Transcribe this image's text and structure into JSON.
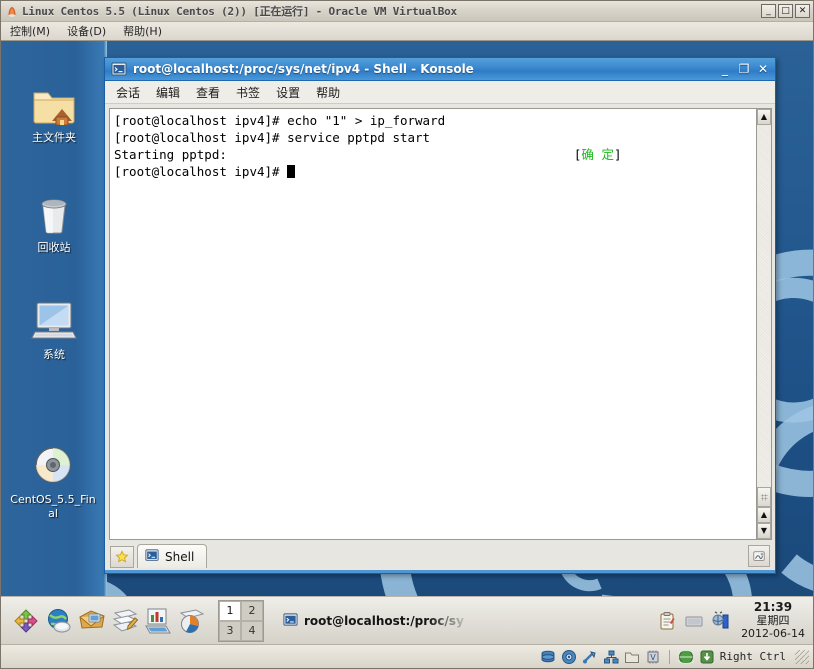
{
  "vbox": {
    "title": "Linux Centos 5.5 (Linux Centos (2)) [正在运行] - Oracle VM VirtualBox",
    "icon": "virtualbox-icon",
    "menu": [
      {
        "label": "控制(M)"
      },
      {
        "label": "设备(D)"
      },
      {
        "label": "帮助(H)"
      }
    ],
    "window_buttons": [
      {
        "name": "minimize",
        "glyph": "_"
      },
      {
        "name": "maximize",
        "glyph": "□"
      },
      {
        "name": "close",
        "glyph": "✕"
      }
    ],
    "status": {
      "icons": [
        "hard-disk-icon",
        "cd-dvd-icon",
        "usb-icon",
        "network-icon",
        "shared-folder-icon",
        "virtualization-icon",
        "globe-icon",
        "host-key-icon"
      ],
      "host_key": "Right Ctrl"
    }
  },
  "desktop": {
    "icons": [
      {
        "name": "home-folder-icon",
        "label": "主文件夹"
      },
      {
        "name": "trash-icon",
        "label": "回收站"
      },
      {
        "name": "computer-icon",
        "label": "系统"
      },
      {
        "name": "cdrom-icon",
        "label": "CentOS_5.5_Final"
      }
    ]
  },
  "konsole": {
    "title": "root@localhost:/proc/sys/net/ipv4 - Shell - Konsole",
    "icon": "konsole-icon",
    "window_buttons": [
      {
        "name": "minimize",
        "glyph": "_"
      },
      {
        "name": "maximize",
        "glyph": "❐"
      },
      {
        "name": "close",
        "glyph": "✕"
      }
    ],
    "menu": [
      {
        "label": "会话"
      },
      {
        "label": "编辑"
      },
      {
        "label": "查看"
      },
      {
        "label": "书签"
      },
      {
        "label": "设置"
      },
      {
        "label": "帮助"
      }
    ],
    "terminal": {
      "lines": [
        {
          "text": "[root@localhost ipv4]# echo \"1\" > ip_forward"
        },
        {
          "text": "[root@localhost ipv4]# service pptpd start"
        },
        {
          "text": "Starting pptpd:",
          "status_open": "[",
          "status_text": "确 定",
          "status_close": "]"
        },
        {
          "text": "[root@localhost ipv4]# ",
          "cursor": true
        }
      ]
    },
    "tabs": [
      {
        "label": "Shell",
        "icon": "konsole-tab-icon"
      }
    ],
    "new_tab_button": "new-session-icon",
    "tab_right_button": "session-options-icon",
    "scrollbar": {
      "up_arrow": "▲",
      "down_arrow": "▼"
    }
  },
  "panel": {
    "launchers": [
      {
        "name": "show-desktop-icon"
      },
      {
        "name": "web-browser-icon"
      },
      {
        "name": "email-icon"
      },
      {
        "name": "writer-icon"
      },
      {
        "name": "spreadsheet-icon"
      },
      {
        "name": "presentation-icon"
      }
    ],
    "pager": [
      {
        "label": "1",
        "active": true
      },
      {
        "label": "2",
        "active": false
      },
      {
        "label": "3",
        "active": false
      },
      {
        "label": "4",
        "active": false
      }
    ],
    "tasks": [
      {
        "label": "root@localhost:/proc/sy",
        "icon": "konsole-task-icon"
      }
    ],
    "tray": [
      {
        "name": "clipboard-icon"
      },
      {
        "name": "display-icon"
      },
      {
        "name": "network-monitor-icon"
      }
    ],
    "clock": {
      "time": "21:39",
      "weekday": "星期四",
      "date": "2012-06-14"
    }
  },
  "colors": {
    "desktop_blue": "#245a90",
    "konsole_title": "#3d8ad0",
    "terminal_ok": "#1fb81f",
    "panel_bg": "#e4e2db"
  }
}
